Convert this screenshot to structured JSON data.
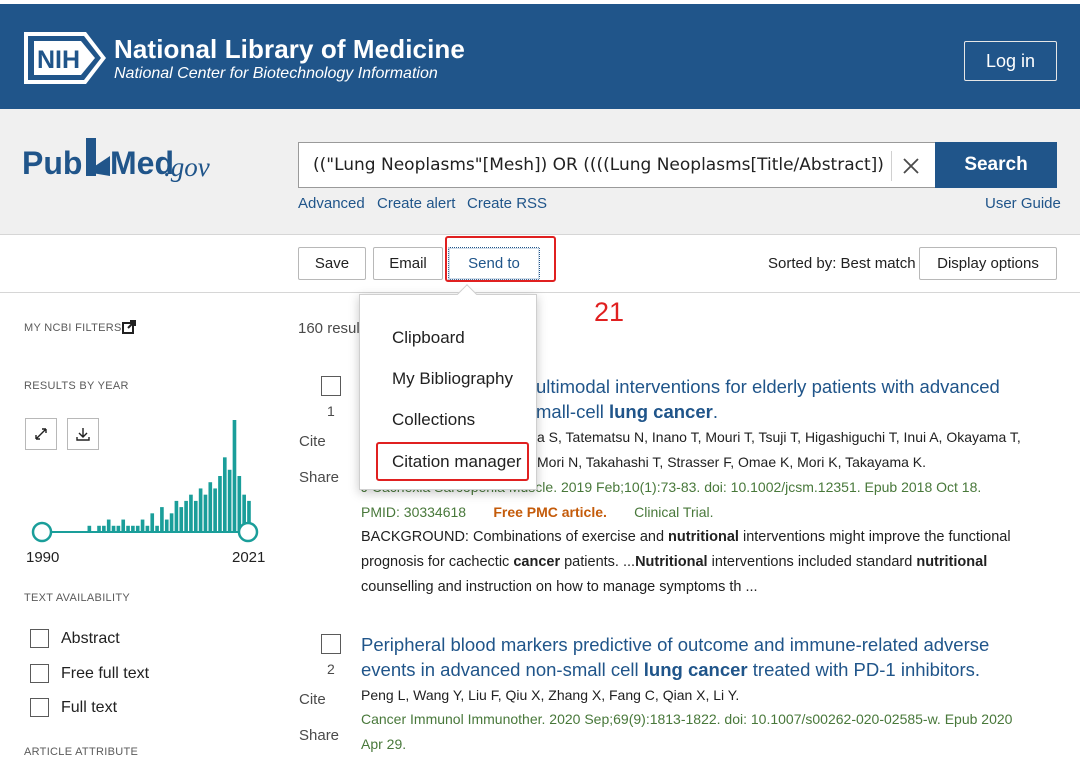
{
  "header": {
    "nih_badge": "NIH",
    "org_title": "National Library of Medicine",
    "org_subtitle": "National Center for Biotechnology Information",
    "login_label": "Log in"
  },
  "search": {
    "logo_pub": "Pub",
    "logo_med": "Med",
    "logo_gov": ".gov",
    "query": "((\"Lung Neoplasms\"[Mesh]) OR ((((Lung Neoplasms[Title/Abstract]) OR (Lung",
    "search_label": "Search",
    "links": [
      "Advanced",
      "Create alert",
      "Create RSS"
    ],
    "user_guide": "User Guide"
  },
  "toolbar": {
    "save_label": "Save",
    "email_label": "Email",
    "sendto_label": "Send to",
    "sorted_label": "Sorted by: Best match",
    "display_options_label": "Display options"
  },
  "sendto_menu": [
    "Clipboard",
    "My Bibliography",
    "Collections",
    "Citation manager"
  ],
  "annotation": {
    "step_number": "21",
    "color": "#e02020"
  },
  "sidebar": {
    "my_ncbi_filters": "MY NCBI FILTERS",
    "results_by_year": "RESULTS BY YEAR",
    "year_start": "1990",
    "year_end": "2021",
    "text_availability": "TEXT AVAILABILITY",
    "filters": [
      "Abstract",
      "Free full text",
      "Full text"
    ],
    "article_attribute": "ARTICLE ATTRIBUTE"
  },
  "results": {
    "count_text": "160 resul",
    "items": [
      {
        "number": "1",
        "cite": "Cite",
        "share": "Share",
        "title_pre": "ultimodal interventions for elderly patients with advanced",
        "title_line2_pre": "mall-cell ",
        "title_line2_bold": "lung cancer",
        "title_line2_post": ".",
        "authors_line1": "a S, Tatematsu N, Inano T, Mouri T, Tsuji T, Higashiguchi T, Inui A, Okayama T,",
        "authors_line2": "Mori N, Takahashi T, Strasser F, Omae K, Mori K, Takayama K.",
        "citation": "J Cachexia Sarcopenia Muscle. 2019 Feb;10(1):73-83. doi: 10.1002/jcsm.12351. Epub 2018 Oct 18.",
        "pmid": "PMID: 30334618",
        "free_pmc": "Free PMC article.",
        "pub_type": "Clinical Trial.",
        "snippet_1a": "BACKGROUND: Combinations of exercise and ",
        "snippet_1b": "nutritional",
        "snippet_1c": " interventions might improve the functional",
        "snippet_2a": "prognosis for cachectic ",
        "snippet_2b": "cancer",
        "snippet_2c": " patients. ...",
        "snippet_2d": "Nutritional",
        "snippet_2e": " interventions included standard ",
        "snippet_2f": "nutritional",
        "snippet_3": "counselling and instruction on how to manage symptoms th ..."
      },
      {
        "number": "2",
        "cite": "Cite",
        "share": "Share",
        "title_line1": "Peripheral blood markers predictive of outcome and immune-related adverse",
        "title_line2_pre": "events in advanced non-small cell ",
        "title_line2_bold": "lung cancer",
        "title_line2_post": " treated with PD-1 inhibitors.",
        "authors": "Peng L, Wang Y, Liu F, Qiu X, Zhang X, Fang C, Qian X, Li Y.",
        "citation_line1": "Cancer Immunol Immunother. 2020 Sep;69(9):1813-1822. doi: 10.1007/s00262-020-02585-w. Epub 2020",
        "citation_line2": "Apr 29."
      }
    ]
  },
  "year_histogram": {
    "type": "bar",
    "values": [
      1,
      0,
      0,
      0,
      0,
      0,
      0,
      0,
      0,
      1,
      0,
      1,
      1,
      2,
      1,
      1,
      2,
      1,
      1,
      1,
      2,
      1,
      3,
      1,
      4,
      2,
      3,
      5,
      4,
      5,
      6,
      5,
      7,
      6,
      8,
      7,
      9,
      12,
      10,
      18,
      9,
      6,
      5
    ]
  },
  "colors": {
    "brand": "#20558a",
    "free_pmc": "#c45b0a",
    "citation_green": "#48783a",
    "bars": "#1a9e9a"
  }
}
